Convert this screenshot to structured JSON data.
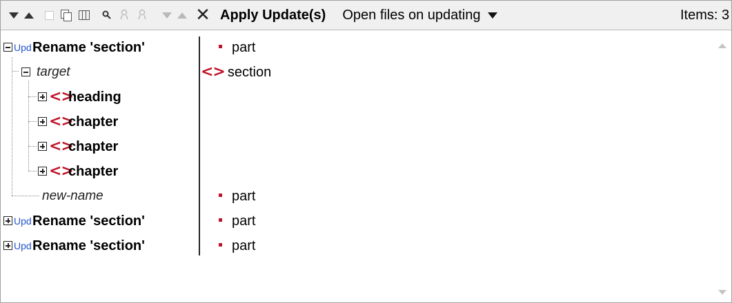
{
  "toolbar": {
    "apply_label": "Apply Update(s)",
    "open_files_label": "Open files on updating",
    "items_label": "Items: 3"
  },
  "tree": {
    "rows": [
      {
        "expander": "minus",
        "badge": "Upd",
        "label": "Rename 'section'",
        "value": "part"
      },
      {
        "expander": "minus",
        "label": "target",
        "value": "section"
      },
      {
        "expander": "plus",
        "label": "heading"
      },
      {
        "expander": "plus",
        "label": "chapter"
      },
      {
        "expander": "plus",
        "label": "chapter"
      },
      {
        "expander": "plus",
        "label": "chapter"
      },
      {
        "label": "new-name",
        "value": "part"
      },
      {
        "expander": "plus",
        "badge": "Upd",
        "label": "Rename 'section'",
        "value": "part"
      },
      {
        "expander": "plus",
        "badge": "Upd",
        "label": "Rename 'section'",
        "value": "part"
      }
    ]
  },
  "icons": {
    "element_tag": "<>",
    "element_color": "#c0142a",
    "upd_badge_color": "#2255cc"
  }
}
